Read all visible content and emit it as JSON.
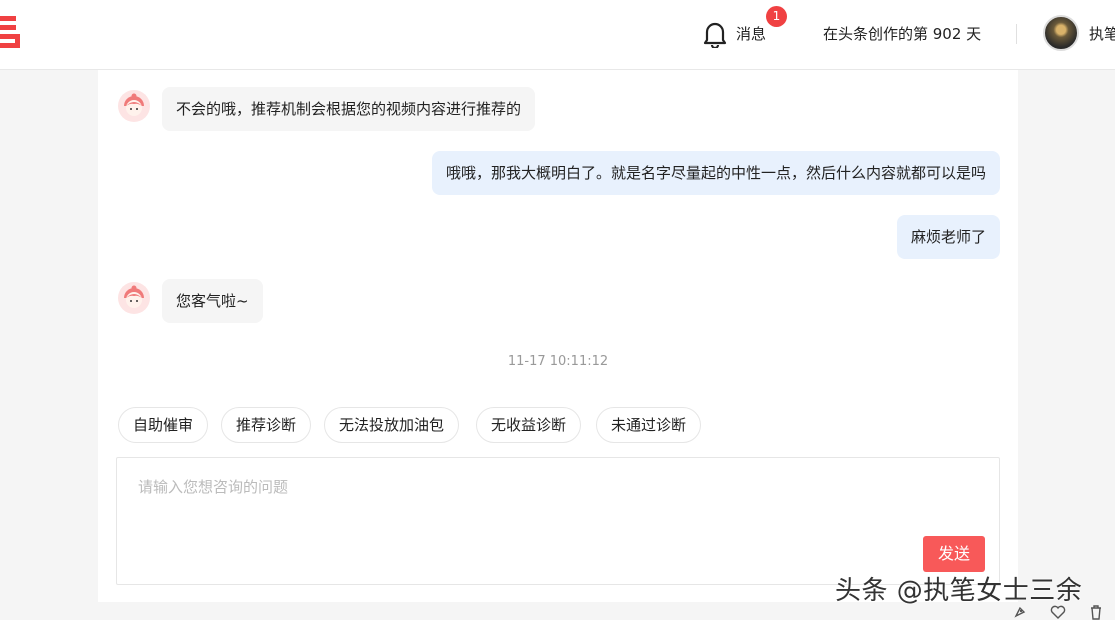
{
  "header": {
    "messages_label": "消息",
    "messages_badge": "1",
    "creation_days": "在头条创作的第 902 天",
    "username": "执笔"
  },
  "chat": {
    "messages": [
      {
        "from": "bot",
        "text": "不会的哦，推荐机制会根据您的视频内容进行推荐的"
      },
      {
        "from": "user",
        "text": "哦哦，那我大概明白了。就是名字尽量起的中性一点，然后什么内容就都可以是吗"
      },
      {
        "from": "user",
        "text": "麻烦老师了"
      },
      {
        "from": "bot",
        "text": "您客气啦~"
      }
    ],
    "timestamp": "11-17 10:11:12"
  },
  "quick_replies": [
    "自助催审",
    "推荐诊断",
    "无法投放加油包",
    "无收益诊断",
    "未通过诊断"
  ],
  "input": {
    "placeholder": "请输入您想咨询的问题",
    "send_label": "发送"
  },
  "watermark": "头条 @执笔女士三余",
  "colors": {
    "accent": "#f85959",
    "badge": "#f04142",
    "user_bubble": "#e8f1fd",
    "bot_bubble": "#f5f5f5"
  },
  "icons": [
    "logo-icon",
    "bell-icon",
    "bot-avatar-icon",
    "rocket-icon",
    "heart-icon",
    "trash-icon"
  ]
}
